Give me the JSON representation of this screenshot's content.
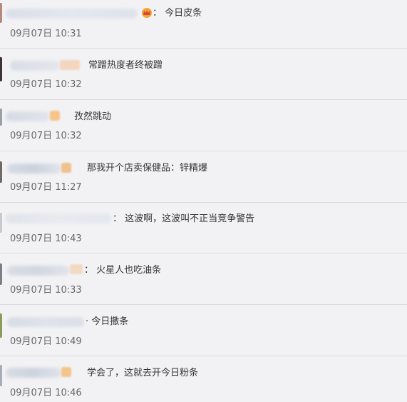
{
  "comments": [
    {
      "text": "：  今日皮条",
      "time": "09月07日 10:31",
      "avatar_color": "#b58a78"
    },
    {
      "text": "常蹭热度者终被蹭",
      "time": "09月07日 10:32",
      "avatar_color": "#3c3238"
    },
    {
      "text": "孜然跳动",
      "time": "09月07日 10:32",
      "avatar_color": "#9aa0a8"
    },
    {
      "text": "那我开个店卖保健品：锌精爆",
      "time": "09月07日 11:27",
      "avatar_color": "#6e6a66"
    },
    {
      "text": "：  这波啊，这波叫不正当竞争警告",
      "time": "09月07日 10:43",
      "avatar_color": "#c6c9cf"
    },
    {
      "text": "：  火星人也吃油条",
      "time": "09月07日 10:33",
      "avatar_color": "#7b7f86"
    },
    {
      "text": "·  今日撒条",
      "time": "09月07日 10:49",
      "avatar_color": "#8a9c58"
    },
    {
      "text": "学会了，这就去开今日粉条",
      "time": "09月07日 10:46",
      "avatar_color": "#a7adb6"
    }
  ]
}
